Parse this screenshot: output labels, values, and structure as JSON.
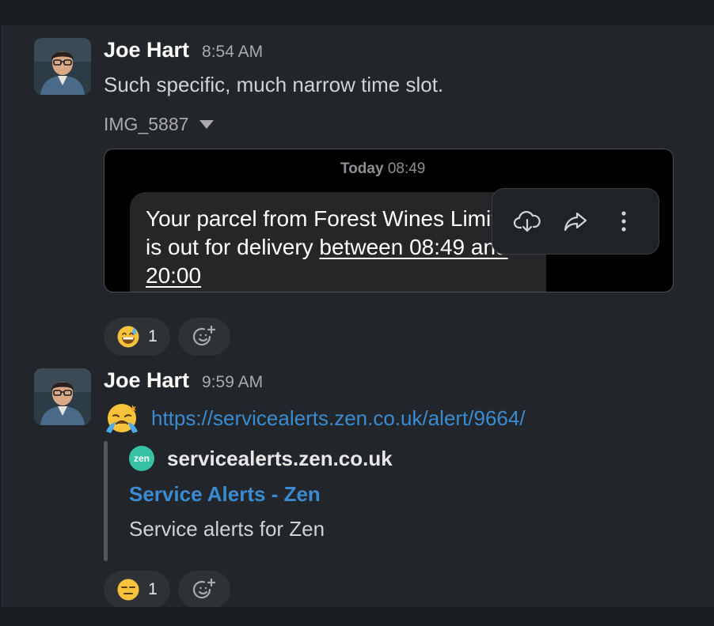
{
  "messages": [
    {
      "sender": "Joe Hart",
      "time": "8:54 AM",
      "text": "Such specific, much narrow time slot.",
      "attachment": {
        "filename": "IMG_5887",
        "sms_date_day": "Today",
        "sms_date_time": "08:49",
        "sms_text_plain": "Your parcel from Forest Wines Limited is out for delivery ",
        "sms_text_underlined": "between 08:49 and 20:00"
      },
      "reactions": [
        {
          "emoji": "grinning-sweat",
          "count": "1"
        }
      ]
    },
    {
      "sender": "Joe Hart",
      "time": "9:59 AM",
      "link": "https://servicealerts.zen.co.uk/alert/9664/",
      "unfurl": {
        "logo_text": "zen",
        "site": "servicealerts.zen.co.uk",
        "title": "Service Alerts - Zen",
        "description": "Service alerts for Zen"
      },
      "reactions": [
        {
          "emoji": "expressionless",
          "count": "1"
        }
      ]
    }
  ],
  "icons": {
    "download": "cloud-download-icon",
    "share": "share-arrow-icon",
    "more": "more-vertical-icon",
    "add_reaction": "add-reaction-icon"
  },
  "colors": {
    "link": "#3a8bd1",
    "background": "#222529",
    "zen_brand": "#37c3a3"
  }
}
